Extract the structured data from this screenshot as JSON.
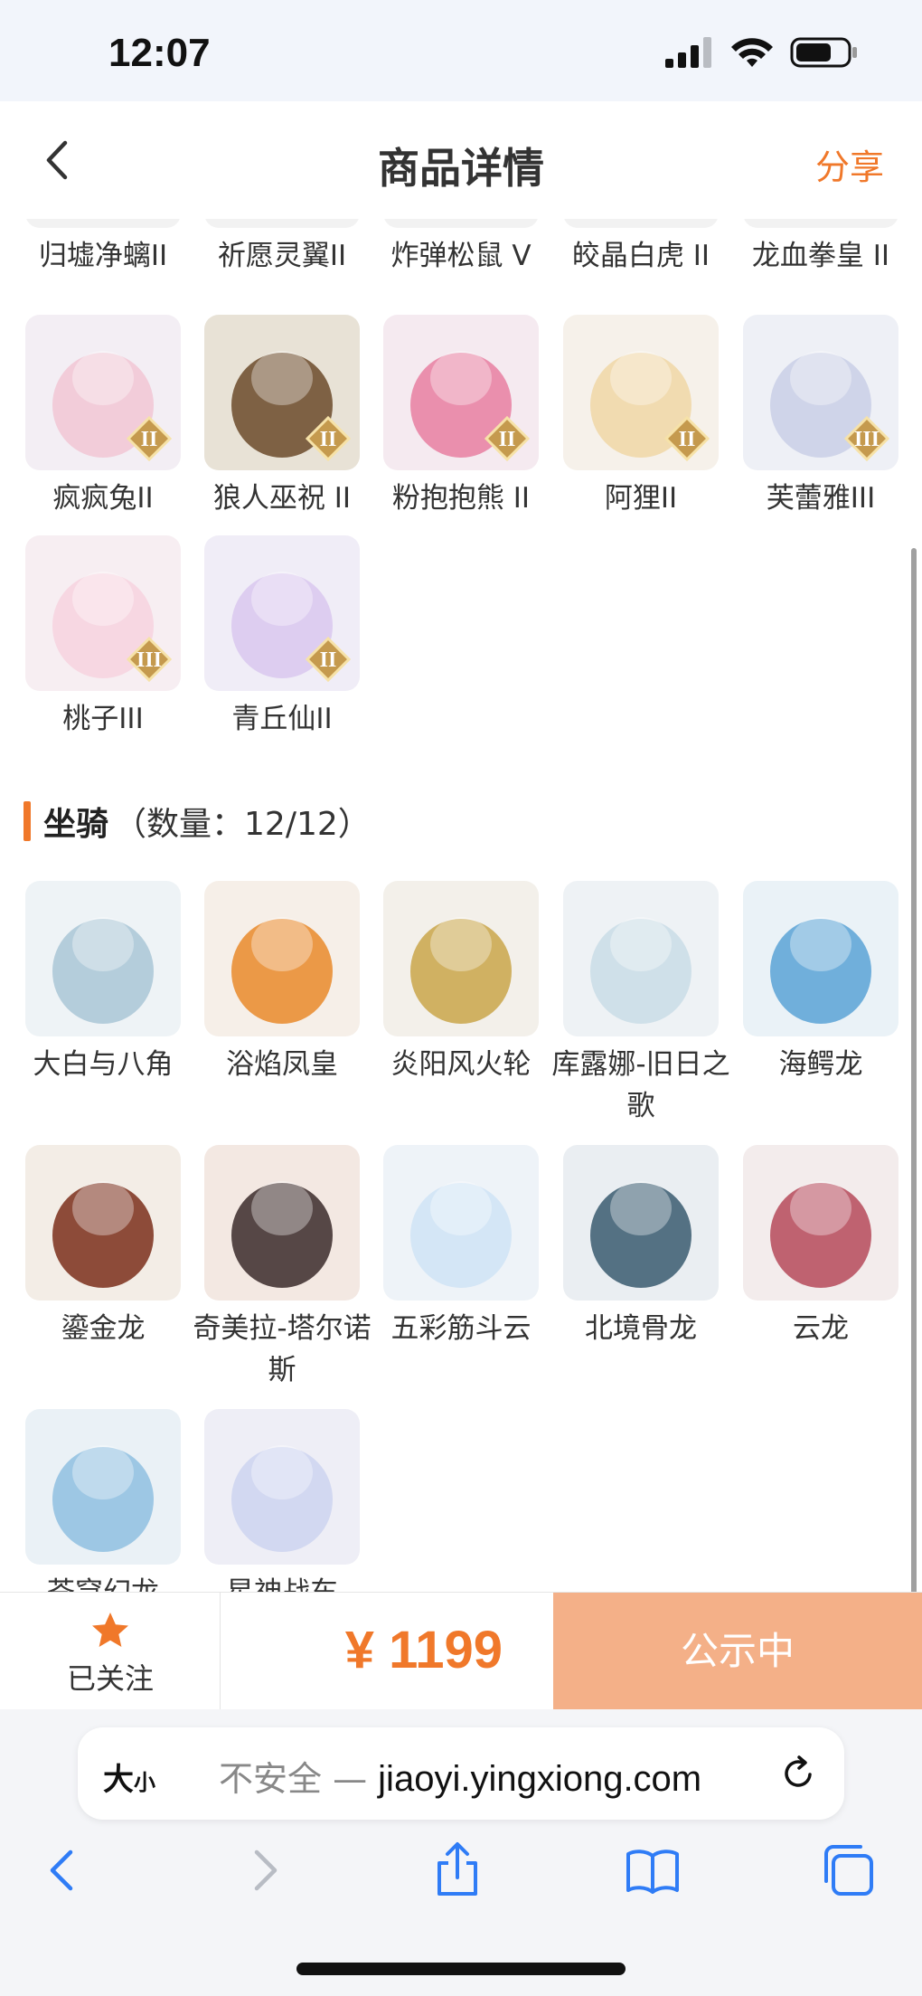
{
  "status": {
    "time": "12:07"
  },
  "header": {
    "title": "商品详情",
    "share": "分享"
  },
  "skins_top_row": [
    "归墟净螭II",
    "祈愿灵翼II",
    "炸弹松鼠 V",
    "皎晶白虎 II",
    "龙血拳皇 II"
  ],
  "skins_row2": [
    {
      "name": "疯疯兔II",
      "tier": "II",
      "icon": "pink-rabbit-icon",
      "bg": "#f3eef4",
      "fg": "#f1c6d4"
    },
    {
      "name": "狼人巫祝 II",
      "tier": "II",
      "icon": "werewolf-icon",
      "bg": "#e8e2d6",
      "fg": "#6b4a2a"
    },
    {
      "name": "粉抱抱熊 II",
      "tier": "II",
      "icon": "pink-bear-icon",
      "bg": "#f5eaf0",
      "fg": "#e77fa1"
    },
    {
      "name": "阿狸II",
      "tier": "II",
      "icon": "fox-cub-icon",
      "bg": "#f6f1ea",
      "fg": "#f0d7a6"
    },
    {
      "name": "芙蕾雅III",
      "tier": "III",
      "icon": "goddess-icon",
      "bg": "#eef0f6",
      "fg": "#c9cfe6"
    }
  ],
  "skins_row3": [
    {
      "name": "桃子III",
      "tier": "III",
      "icon": "pink-cat-icon",
      "bg": "#f7eef2",
      "fg": "#f7d2df"
    },
    {
      "name": "青丘仙II",
      "tier": "II",
      "icon": "fox-fairy-icon",
      "bg": "#f0edf7",
      "fg": "#d9c7ef"
    }
  ],
  "mounts_section": {
    "title": "坐骑",
    "count": "（数量：12/12）"
  },
  "mounts_row1": [
    {
      "name": "大白与八角",
      "icon": "whale-icon",
      "bg": "#eef3f6",
      "fg": "#a9c6d6"
    },
    {
      "name": "浴焰凤皇",
      "icon": "phoenix-icon",
      "bg": "#f6efe8",
      "fg": "#e98a2a"
    },
    {
      "name": "炎阳风火轮",
      "icon": "fire-wheel-icon",
      "bg": "#f3f0ea",
      "fg": "#c9a64a"
    },
    {
      "name": "库露娜-旧日之歌",
      "icon": "doll-icon",
      "bg": "#eef2f5",
      "fg": "#c9dde6"
    },
    {
      "name": "海鳄龙",
      "icon": "sea-dragon-icon",
      "bg": "#eaf2f7",
      "fg": "#5aa3d6"
    }
  ],
  "mounts_row2": [
    {
      "name": "鎏金龙",
      "icon": "gold-dragon-icon",
      "bg": "#f3ede6",
      "fg": "#7a2e1a"
    },
    {
      "name": "奇美拉-塔尔诺斯",
      "icon": "chimera-icon",
      "bg": "#f3e8e2",
      "fg": "#3a2a2a"
    },
    {
      "name": "五彩筋斗云",
      "icon": "cloud-icon",
      "bg": "#eef3f8",
      "fg": "#cfe3f6"
    },
    {
      "name": "北境骨龙",
      "icon": "bone-dragon-icon",
      "bg": "#eaeef2",
      "fg": "#3a5a70"
    },
    {
      "name": "云龙",
      "icon": "cloud-dragon-icon",
      "bg": "#f3ecec",
      "fg": "#b54a5a"
    }
  ],
  "mounts_row3": [
    {
      "name": "苍穹幻龙",
      "icon": "sky-dragon-icon",
      "bg": "#eaf1f6",
      "fg": "#8fc0e0"
    },
    {
      "name": "星神战车",
      "icon": "star-steed-icon",
      "bg": "#eeeef6",
      "fg": "#cdd3f0"
    }
  ],
  "action": {
    "follow": "已关注",
    "price": "¥ 1199",
    "status": "公示中"
  },
  "safari": {
    "text_size": "大",
    "text_size_small": "小",
    "insecure": "不安全 — ",
    "domain": "jiaoyi.yingxiong.com"
  },
  "colors": {
    "accent": "#f0782a",
    "button": "#f4b088"
  }
}
